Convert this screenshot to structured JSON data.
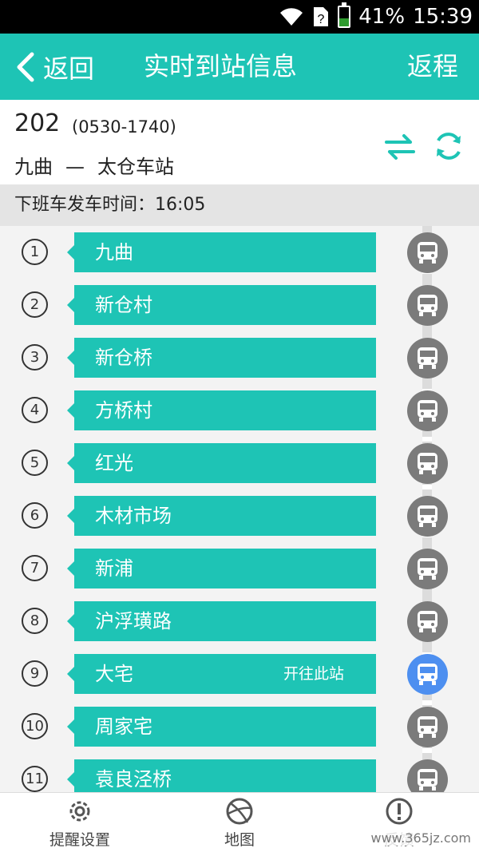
{
  "status_bar": {
    "battery": "41%",
    "time": "15:39",
    "wifi_icon": "wifi-icon",
    "sim_icon": "sim-unknown-icon",
    "battery_level": 0.41
  },
  "header": {
    "back_label": "返回",
    "title": "实时到站信息",
    "return_label": "返程"
  },
  "route": {
    "number": "202",
    "hours": "(0530-1740)",
    "origin": "九曲",
    "separator": "—",
    "destination": "太仓车站"
  },
  "next_departure": "下班车发车时间：16:05",
  "stops": [
    {
      "index": "1",
      "name": "九曲",
      "note": ""
    },
    {
      "index": "2",
      "name": "新仓村",
      "note": ""
    },
    {
      "index": "3",
      "name": "新仓桥",
      "note": ""
    },
    {
      "index": "4",
      "name": "方桥村",
      "note": ""
    },
    {
      "index": "5",
      "name": "红光",
      "note": ""
    },
    {
      "index": "6",
      "name": "木材市场",
      "note": ""
    },
    {
      "index": "7",
      "name": "新浦",
      "note": ""
    },
    {
      "index": "8",
      "name": "沪浮璜路",
      "note": ""
    },
    {
      "index": "9",
      "name": "大宅",
      "note": "开往此站"
    },
    {
      "index": "10",
      "name": "周家宅",
      "note": ""
    },
    {
      "index": "11",
      "name": "袁良泾桥",
      "note": ""
    }
  ],
  "bottom_nav": {
    "reminder_label": "提醒设置",
    "map_label": "地图",
    "feedback_label": "反馈"
  },
  "watermark": "www.365jz.com",
  "colors": {
    "accent": "#1ec4b5",
    "bus_inactive": "#7b7b7b",
    "bus_active": "#4d8ff0"
  }
}
